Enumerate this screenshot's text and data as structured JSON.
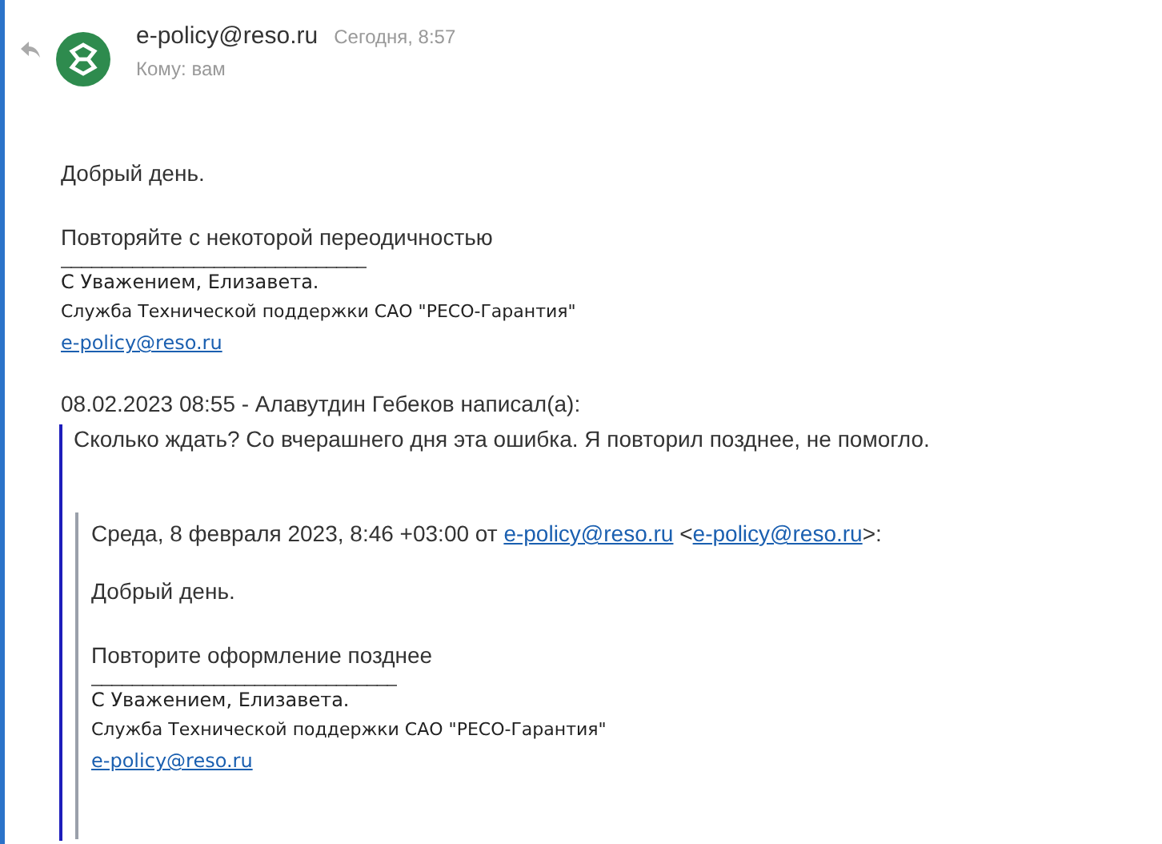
{
  "header": {
    "sender": "e-policy@reso.ru",
    "date": "Сегодня, 8:57",
    "recipient": "Кому: вам"
  },
  "body": {
    "greeting": "Добрый день.",
    "message": "Повторяйте с некоторой переодичностью",
    "rule": "______________________________",
    "signature": "С Уважением, Елизавета.",
    "department": "Служба Технической поддержки САО \"РЕСО-Гарантия\"",
    "email": "e-policy@reso.ru"
  },
  "quote": {
    "attribution": "08.02.2023 08:55 - Алавутдин Гебеков написал(а):",
    "message": "Сколько ждать? Со вчерашнего дня эта ошибка. Я повторил позднее, не помогло.",
    "nested": {
      "attribution_prefix": "Среда, 8 февраля 2023, 8:46 +03:00 от",
      "from_link": "e-policy@reso.ru",
      "bracket_open": "<",
      "bracket_link": "e-policy@reso.ru",
      "bracket_close": ">:",
      "greeting": "Добрый день.",
      "message": "Повторите оформление позднее",
      "rule": "______________________________",
      "signature": "С Уважением, Елизавета.",
      "department": "Служба Технической поддержки САО \"РЕСО-Гарантия\"",
      "email": "e-policy@reso.ru"
    }
  }
}
